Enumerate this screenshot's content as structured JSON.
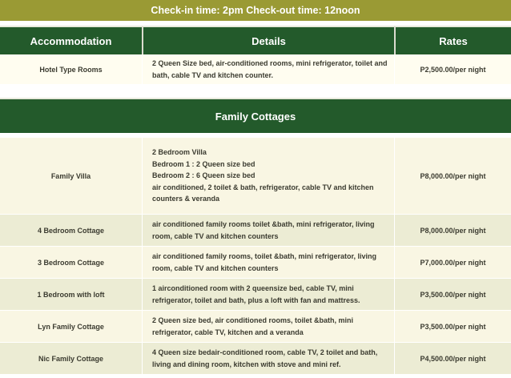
{
  "banner": "Check-in time: 2pm Check-out time: 12noon",
  "headers": {
    "accommodation": "Accommodation",
    "details": "Details",
    "rates": "Rates"
  },
  "hotel_row": {
    "name": "Hotel Type Rooms",
    "details": [
      "2 Queen Size bed, air-conditioned rooms, mini refrigerator, toilet and",
      "bath, cable TV and kitchen counter."
    ],
    "rate": "P2,500.00/per night"
  },
  "section_title": "Family Cottages",
  "rows": [
    {
      "name": "Family Villa",
      "details": [
        "2 Bedroom Villa",
        "Bedroom 1 : 2 Queen size bed",
        "Bedroom 2 : 6 Queen size bed",
        "air conditioned, 2 toilet & bath, refrigerator, cable TV and kitchen",
        "counters & veranda"
      ],
      "rate": "P8,000.00/per night"
    },
    {
      "name": "4 Bedroom Cottage",
      "details": [
        "air conditioned family rooms toilet &bath, mini refrigerator, living",
        "room, cable TV and kitchen counters"
      ],
      "rate": "P8,000.00/per night"
    },
    {
      "name": "3 Bedroom Cottage",
      "details": [
        "air conditioned family rooms, toilet &bath, mini refrigerator, living",
        "room, cable TV and kitchen counters"
      ],
      "rate": "P7,000.00/per night"
    },
    {
      "name": "1 Bedroom with loft",
      "details": [
        "1 airconditioned room with 2 queensize bed, cable TV, mini",
        "refrigerator, toilet and bath, plus a loft with fan and mattress."
      ],
      "rate": "P3,500.00/per night"
    },
    {
      "name": "Lyn Family Cottage",
      "details": [
        "2 Queen size bed, air conditioned rooms, toilet &bath, mini",
        "refrigerator, cable TV, kitchen and a veranda"
      ],
      "rate": "P3,500.00/per night"
    },
    {
      "name": "Nic Family Cottage",
      "details": [
        "4 Queen size bedair-conditioned room, cable TV, 2 toilet and bath,",
        "living and dining room, kitchen with stove and mini ref."
      ],
      "rate": "P4,500.00/per night"
    }
  ]
}
